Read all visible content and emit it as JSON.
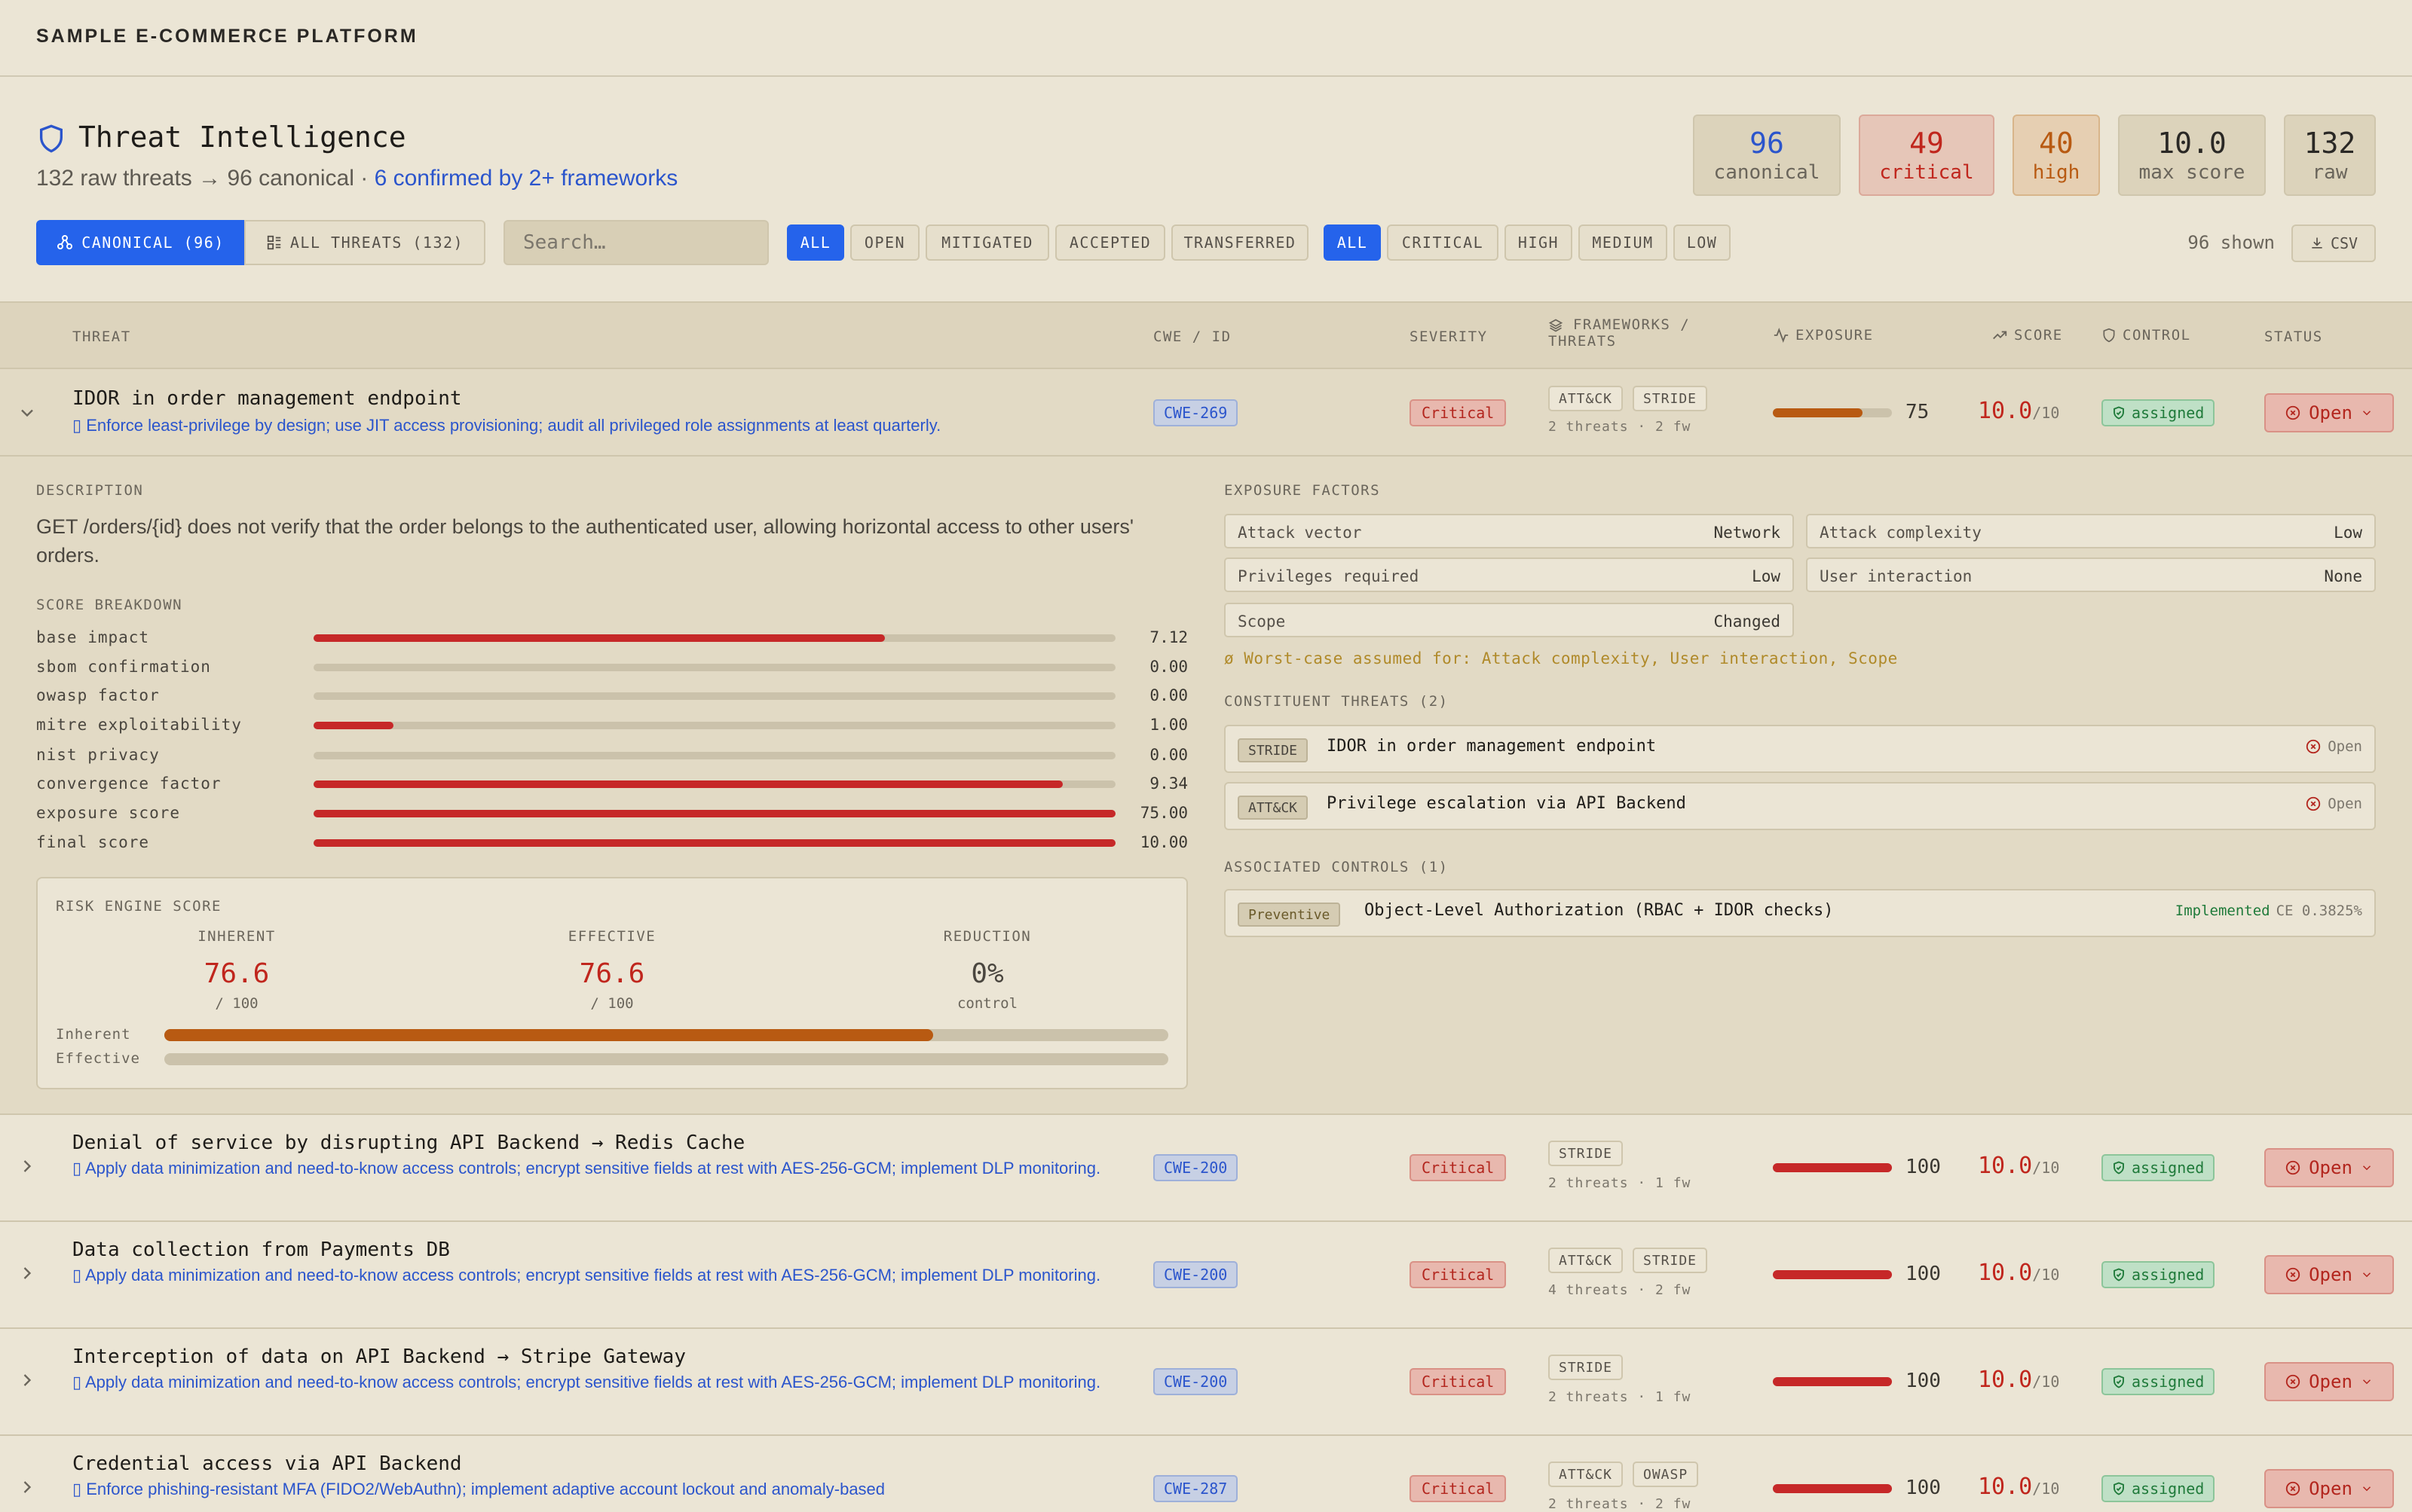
{
  "app": {
    "title": "SAMPLE E-COMMERCE PLATFORM"
  },
  "header": {
    "title": "Threat Intelligence",
    "subtitle_main": "132 raw threats → 96 canonical · ",
    "subtitle_link": "6 confirmed by 2+ frameworks"
  },
  "stats": [
    {
      "value": "96",
      "label": "canonical",
      "color": "#2b55cc"
    },
    {
      "value": "49",
      "label": "critical",
      "color": "#c0261d"
    },
    {
      "value": "40",
      "label": "high",
      "color": "#b85a12"
    },
    {
      "value": "10.0",
      "label": "max score",
      "color": "#1e1c19"
    },
    {
      "value": "132",
      "label": "raw",
      "color": "#1e1c19"
    }
  ],
  "filters": {
    "view_canonical": "CANONICAL (96)",
    "view_all": "ALL THREATS (132)",
    "search_placeholder": "Search…",
    "status_chips": [
      "ALL",
      "OPEN",
      "MITIGATED",
      "ACCEPTED",
      "TRANSFERRED"
    ],
    "severity_chips": [
      "ALL",
      "CRITICAL",
      "HIGH",
      "MEDIUM",
      "LOW"
    ],
    "shown": "96 shown",
    "csv": "CSV"
  },
  "columns": {
    "threat": "THREAT",
    "cwe": "CWE / ID",
    "severity": "SEVERITY",
    "frameworks_1": "FRAMEWORKS /",
    "frameworks_2": "THREATS",
    "exposure": "EXPOSURE",
    "score": "SCORE",
    "control": "CONTROL",
    "status": "STATUS"
  },
  "rows": [
    {
      "name": "IDOR in order management endpoint",
      "mitigation": "▯ Enforce least-privilege by design; use JIT access provisioning; audit all privileged role assignments at least quarterly.",
      "cwe": "CWE-269",
      "severity": "Critical",
      "fw1": "ATT&CK",
      "fw2": "STRIDE",
      "fw_meta": "2 threats · 2 fw",
      "exposure": 75,
      "exposure_label": "75",
      "exposure_color": "#b85a12",
      "score": "10.0",
      "score_suffix": "/10",
      "control": "assigned",
      "status": "Open"
    },
    {
      "name": "Denial of service by disrupting API Backend → Redis Cache",
      "mitigation": "▯ Apply data minimization and need-to-know access controls; encrypt sensitive fields at rest with AES-256-GCM; implement DLP monitoring.",
      "cwe": "CWE-200",
      "severity": "Critical",
      "fw1": "STRIDE",
      "fw2": "",
      "fw_meta": "2 threats · 1 fw",
      "exposure": 100,
      "exposure_label": "100",
      "exposure_color": "#c62828",
      "score": "10.0",
      "score_suffix": "/10",
      "control": "assigned",
      "status": "Open"
    },
    {
      "name": "Data collection from Payments DB",
      "mitigation": "▯ Apply data minimization and need-to-know access controls; encrypt sensitive fields at rest with AES-256-GCM; implement DLP monitoring.",
      "cwe": "CWE-200",
      "severity": "Critical",
      "fw1": "ATT&CK",
      "fw2": "STRIDE",
      "fw_meta": "4 threats · 2 fw",
      "exposure": 100,
      "exposure_label": "100",
      "exposure_color": "#c62828",
      "score": "10.0",
      "score_suffix": "/10",
      "control": "assigned",
      "status": "Open"
    },
    {
      "name": "Interception of data on API Backend → Stripe Gateway",
      "mitigation": "▯ Apply data minimization and need-to-know access controls; encrypt sensitive fields at rest with AES-256-GCM; implement DLP monitoring.",
      "cwe": "CWE-200",
      "severity": "Critical",
      "fw1": "STRIDE",
      "fw2": "",
      "fw_meta": "2 threats · 1 fw",
      "exposure": 100,
      "exposure_label": "100",
      "exposure_color": "#c62828",
      "score": "10.0",
      "score_suffix": "/10",
      "control": "assigned",
      "status": "Open"
    },
    {
      "name": "Credential access via API Backend",
      "mitigation": "▯ Enforce phishing-resistant MFA (FIDO2/WebAuthn); implement adaptive account lockout and anomaly-based",
      "cwe": "CWE-287",
      "severity": "Critical",
      "fw1": "ATT&CK",
      "fw2": "OWASP",
      "fw_meta": "2 threats · 2 fw",
      "exposure": 100,
      "exposure_label": "100",
      "exposure_color": "#c62828",
      "score": "10.0",
      "score_suffix": "/10",
      "control": "assigned",
      "status": "Open"
    }
  ],
  "detail": {
    "description_label": "DESCRIPTION",
    "description": "GET /orders/{id} does not verify that the order belongs to the authenticated user, allowing horizontal access to other users' orders.",
    "breakdown_label": "SCORE BREAKDOWN",
    "breakdown": [
      {
        "label": "base impact",
        "value": "7.12",
        "fraction": 0.712
      },
      {
        "label": "sbom confirmation",
        "value": "0.00",
        "fraction": 0
      },
      {
        "label": "owasp factor",
        "value": "0.00",
        "fraction": 0
      },
      {
        "label": "mitre exploitability",
        "value": "1.00",
        "fraction": 0.1
      },
      {
        "label": "nist privacy",
        "value": "0.00",
        "fraction": 0
      },
      {
        "label": "convergence factor",
        "value": "9.34",
        "fraction": 0.934
      },
      {
        "label": "exposure score",
        "value": "75.00",
        "fraction": 1
      },
      {
        "label": "final score",
        "value": "10.00",
        "fraction": 1
      }
    ],
    "risk": {
      "title": "RISK ENGINE SCORE",
      "inherent_label": "INHERENT",
      "inherent_value": "76.6",
      "inherent_sub": "/ 100",
      "effective_label": "EFFECTIVE",
      "effective_value": "76.6",
      "effective_sub": "/ 100",
      "reduction_label": "REDUCTION",
      "reduction_value": "0%",
      "reduction_sub": "control",
      "bar_inherent_label": "Inherent",
      "bar_inherent_fraction": 0.766,
      "bar_effective_label": "Effective",
      "bar_effective_fraction": 0
    },
    "exposure_label": "EXPOSURE FACTORS",
    "factors": [
      {
        "key": "Attack vector",
        "value": "Network"
      },
      {
        "key": "Attack complexity",
        "value": "Low"
      },
      {
        "key": "Privileges required",
        "value": "Low"
      },
      {
        "key": "User interaction",
        "value": "None"
      },
      {
        "key": "Scope",
        "value": "Changed"
      }
    ],
    "worst_case": "ø Worst-case assumed for: Attack complexity, User interaction, Scope",
    "constituent_label": "CONSTITUENT THREATS (2)",
    "constituents": [
      {
        "tag": "STRIDE",
        "name": "IDOR in order management endpoint",
        "status": "Open"
      },
      {
        "tag": "ATT&CK",
        "name": "Privilege escalation via API Backend",
        "status": "Open"
      }
    ],
    "controls_label": "ASSOCIATED CONTROLS (1)",
    "controls": [
      {
        "tag": "Preventive",
        "name": "Object-Level Authorization (RBAC + IDOR checks)",
        "state": "Implemented",
        "ce": "CE 0.3825%"
      }
    ]
  }
}
